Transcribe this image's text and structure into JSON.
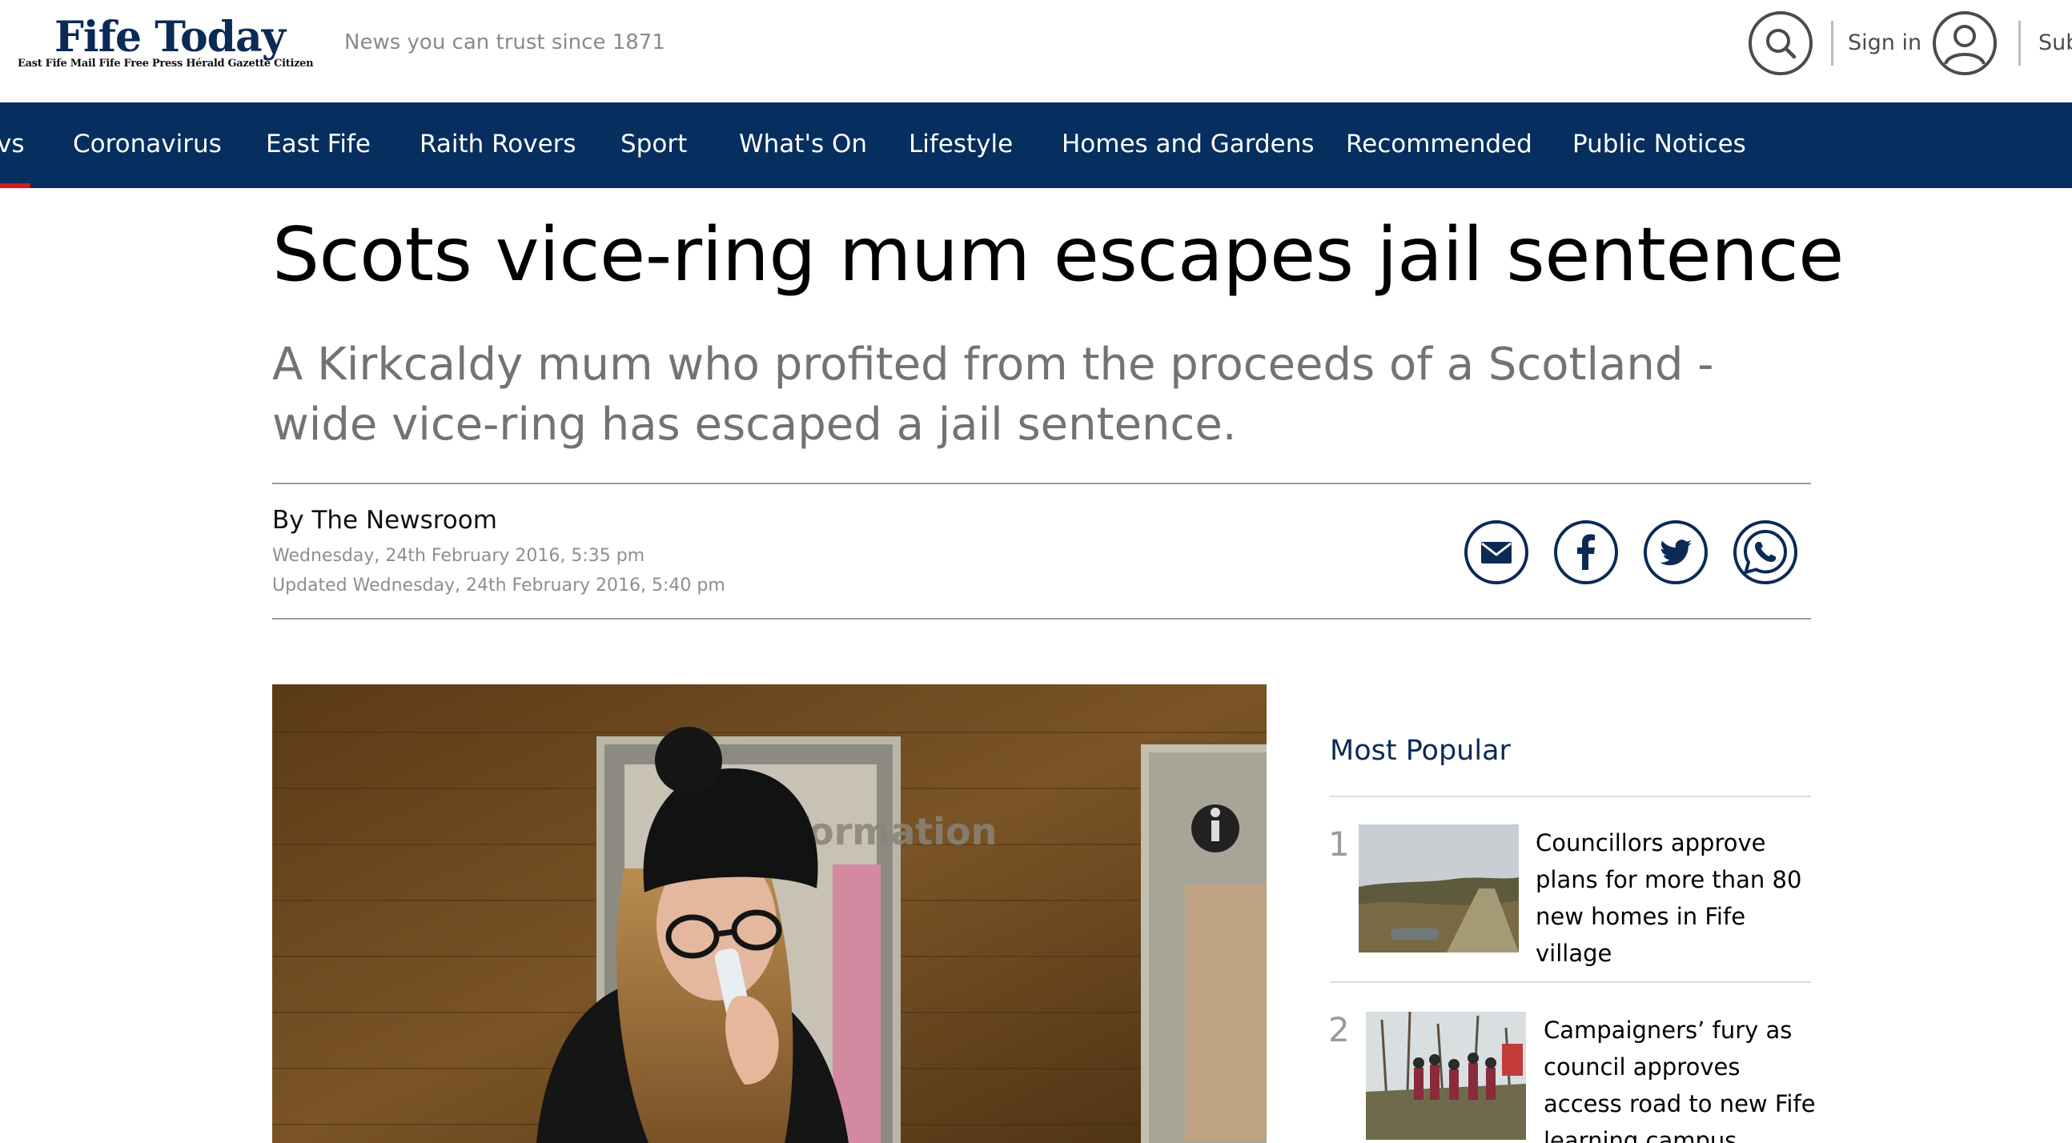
{
  "header": {
    "logo_title": "Fife Today",
    "logo_sub": "East Fife Mail  Fife Free Press  Hérald  Gazette  Citizen",
    "tagline": "News you can trust since 1871",
    "sign_in_label": "Sign in",
    "subscribe_label": "Sub",
    "icons": {
      "search": "search-icon",
      "account": "user-icon"
    }
  },
  "nav": {
    "active_partial": "vs",
    "items": [
      "Coronavirus",
      "East Fife",
      "Raith Rovers",
      "Sport",
      "What's On",
      "Lifestyle",
      "Homes and Gardens",
      "Recommended",
      "Public Notices"
    ],
    "accent_color": "#d71920",
    "background_color": "#062e5e"
  },
  "article": {
    "headline": "Scots vice-ring mum escapes jail sentence",
    "standfirst": "A Kirkcaldy mum who profited from the proceeds of a Scotland -wide vice-ring has escaped a jail sentence.",
    "byline": "By The Newsroom",
    "published": "Wednesday, 24th February 2016, 5:35 pm",
    "updated": "Updated  Wednesday, 24th February 2016, 5:40 pm",
    "share_icons": [
      "email-icon",
      "facebook-icon",
      "twitter-icon",
      "whatsapp-icon"
    ],
    "image_sign_text": "formation"
  },
  "most_popular": {
    "title": "Most Popular",
    "items": [
      {
        "rank": "1",
        "title": "Councillors approve plans for more than 80 new homes in Fife village"
      },
      {
        "rank": "2",
        "title": "Campaigners’ fury as council approves access road to new Fife learning campus"
      }
    ]
  }
}
